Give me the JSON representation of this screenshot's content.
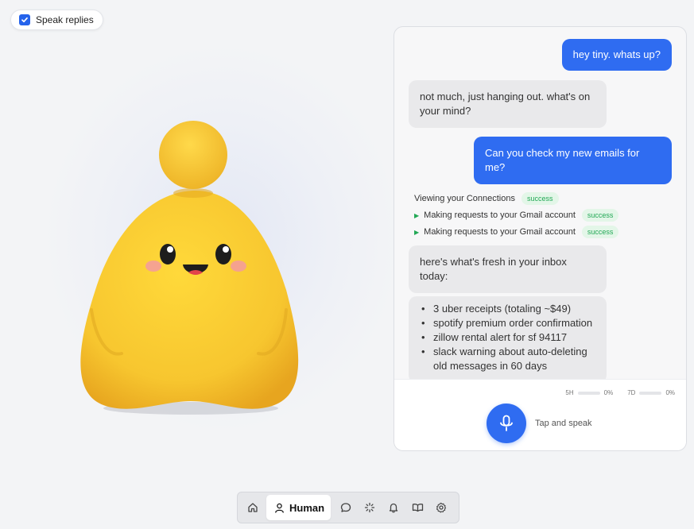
{
  "speak_replies": {
    "label": "Speak replies",
    "checked": true
  },
  "chat": {
    "messages": [
      {
        "role": "user",
        "text": "hey tiny. whats up?"
      },
      {
        "role": "assistant",
        "text": "not much, just hanging out. what's on your mind?"
      },
      {
        "role": "user",
        "text": "Can you check my new emails for me?"
      }
    ],
    "tool_calls": [
      {
        "label": "Viewing your Connections",
        "status": "success"
      },
      {
        "label": "Making requests to your Gmail account",
        "status": "success"
      },
      {
        "label": "Making requests to your Gmail account",
        "status": "success"
      }
    ],
    "reply_intro": "here's what's fresh in your inbox today:",
    "reply_items": [
      "3 uber receipts (totaling ~$49)",
      "spotify premium order confirmation",
      "zillow rental alert for sf 94117",
      "slack warning about auto-deleting old messages in 60 days"
    ]
  },
  "usage": {
    "five_hour": {
      "label": "5H",
      "value": "0%"
    },
    "seven_day": {
      "label": "7D",
      "value": "0%"
    }
  },
  "voice": {
    "tap_label": "Tap and speak"
  },
  "nav": {
    "active_label": "Human",
    "items": [
      "home-icon",
      "person-icon",
      "chat-icon",
      "sparkle-icon",
      "bell-icon",
      "book-icon",
      "gear-icon"
    ]
  },
  "colors": {
    "accent": "#2f6cf1",
    "success": "#22a855",
    "mascot": "#f7c62f"
  }
}
